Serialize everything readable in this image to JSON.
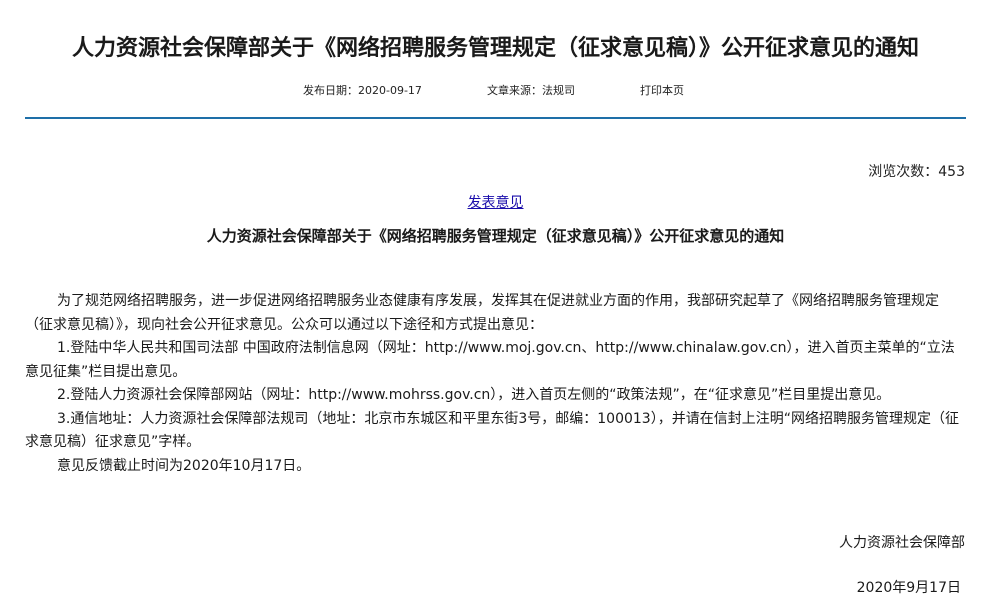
{
  "header": {
    "title": "人力资源社会保障部关于《网络招聘服务管理规定（征求意见稿）》公开征求意见的通知",
    "publish_label": "发布日期：",
    "publish_date": "2020-09-17",
    "source_label": "文章来源：",
    "source": "法规司",
    "print_label": "打印本页"
  },
  "stats": {
    "views_label": "浏览次数：",
    "views_count": "453"
  },
  "comment_link": "发表意见",
  "article": {
    "subtitle": "人力资源社会保障部关于《网络招聘服务管理规定（征求意见稿）》公开征求意见的通知",
    "paragraphs": [
      "为了规范网络招聘服务，进一步促进网络招聘服务业态健康有序发展，发挥其在促进就业方面的作用，我部研究起草了《网络招聘服务管理规定（征求意见稿）》，现向社会公开征求意见。公众可以通过以下途径和方式提出意见：",
      "1.登陆中华人民共和国司法部 中国政府法制信息网（网址：http://www.moj.gov.cn、http://www.chinalaw.gov.cn），进入首页主菜单的“立法意见征集”栏目提出意见。",
      "2.登陆人力资源社会保障部网站（网址：http://www.mohrss.gov.cn），进入首页左侧的“政策法规”，在“征求意见”栏目里提出意见。",
      "3.通信地址：人力资源社会保障部法规司（地址：北京市东城区和平里东街3号，邮编：100013），并请在信封上注明“网络招聘服务管理规定（征求意见稿）征求意见”字样。",
      "意见反馈截止时间为2020年10月17日。"
    ],
    "signature": "人力资源社会保障部",
    "sign_date": "2020年9月17日"
  },
  "colors": {
    "divider": "#1e6fa8",
    "link": "#1a0dab"
  }
}
